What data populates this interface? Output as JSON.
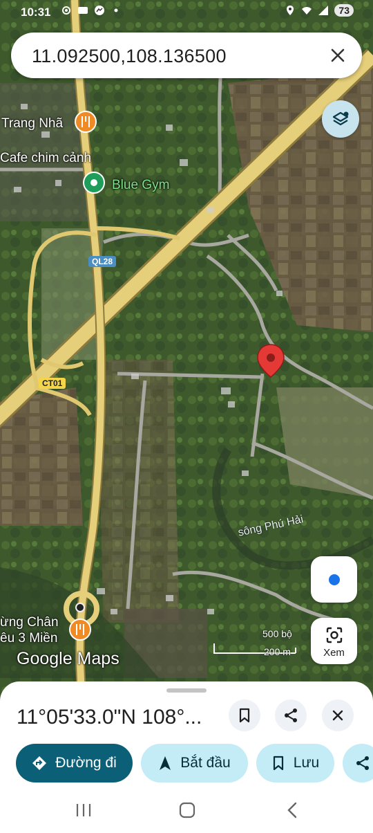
{
  "status_bar": {
    "time": "10:31",
    "left_icons": [
      "settings-icon",
      "notification-icon",
      "messenger-icon",
      "dot-icon"
    ],
    "right_icons": [
      "location-icon",
      "wifi-icon",
      "signal-icon"
    ],
    "battery": "73"
  },
  "search": {
    "query": "11.092500,108.136500",
    "clear_icon": "close-icon"
  },
  "map": {
    "poi": [
      {
        "name": "Trang Nhã",
        "icon": "restaurant-icon"
      },
      {
        "name": "Cafe chim cảnh",
        "icon": ""
      },
      {
        "name": "Blue Gym",
        "icon": "gym-icon"
      },
      {
        "name": "ừng Chân\nêu 3 Miền",
        "icon": "restaurant-icon"
      }
    ],
    "road_labels": [
      "QL28",
      "CT01"
    ],
    "river_label": "sông Phú Hải",
    "scale": {
      "top": "500 bộ",
      "bottom": "200 m"
    },
    "logo": "Google Maps",
    "pin_color": "#e53935",
    "colors": {
      "highway": "#e6cf7a",
      "road": "#b9b9b9",
      "poi_orange": "#f08a24",
      "poi_green": "#1e9e5a"
    }
  },
  "controls": {
    "layers_icon": "layers-icon",
    "my_location_icon": "my-location-icon",
    "xem_label": "Xem",
    "xem_icon": "lens-icon"
  },
  "sheet": {
    "coords": "11°05'33.0\"N 108°...",
    "actions": [
      "bookmark-icon",
      "share-icon",
      "close-icon"
    ],
    "chips": [
      {
        "label": "Đường đi",
        "icon": "directions-icon"
      },
      {
        "label": "Bắt đầu",
        "icon": "navigation-icon"
      },
      {
        "label": "Lưu",
        "icon": "bookmark-icon"
      },
      {
        "label": "",
        "icon": "share-icon"
      }
    ]
  },
  "nav_bar": [
    "recents-icon",
    "home-icon",
    "back-icon"
  ]
}
